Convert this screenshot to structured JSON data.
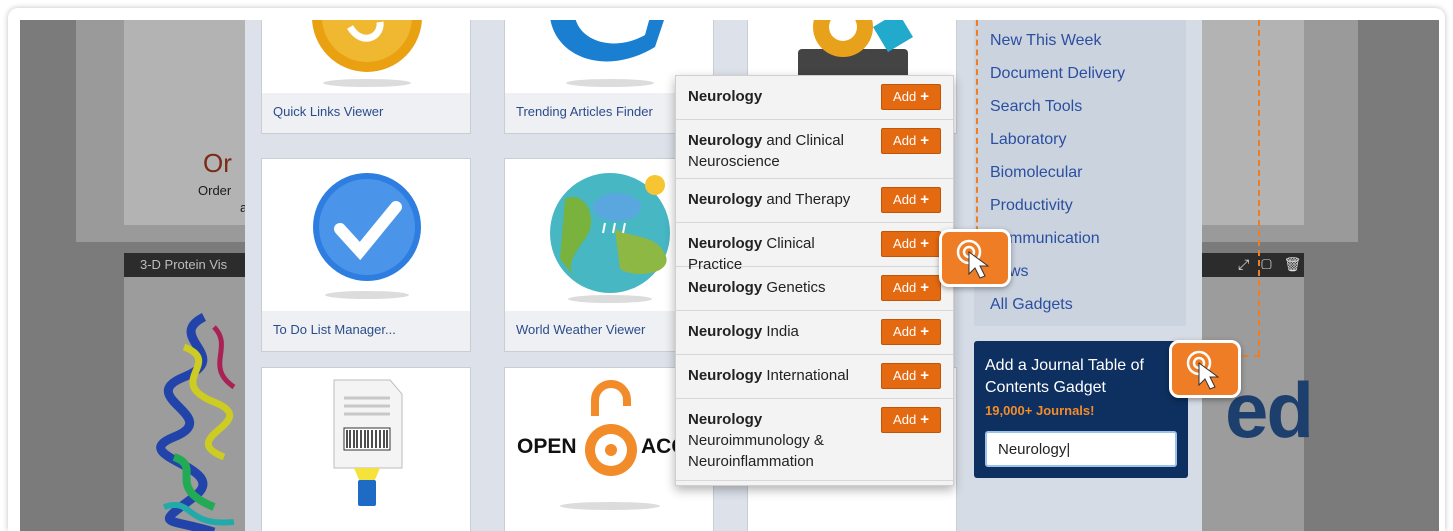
{
  "gallery": {
    "tiles": [
      {
        "caption": "Quick Links Viewer"
      },
      {
        "caption": "Trending Articles Finder"
      },
      {
        "caption": "To Do List Manager..."
      },
      {
        "caption": "World Weather Viewer"
      },
      {
        "caption": ""
      },
      {
        "caption": ""
      }
    ],
    "open_access_text": {
      "left": "OPEN",
      "right": "ACCE"
    }
  },
  "background": {
    "order_title": "Or",
    "order_text": "Order",
    "order_text2": "a",
    "panel_title": "3-D Protein Vis",
    "logo_fragment": "ed",
    "panel_tools": "⤢ ▢ 🗑"
  },
  "sidebar": {
    "categories": [
      "New This Week",
      "Document Delivery",
      "Search Tools",
      "Laboratory",
      "Biomolecular",
      "Productivity",
      "mmunication",
      "ws",
      "All Gadgets"
    ],
    "journal": {
      "title": "Add a Journal Table of Contents Gadget",
      "count": "19,000+ Journals!",
      "input_value": "Neurology|"
    }
  },
  "dropdown": {
    "add_label": "Add",
    "items": [
      {
        "bold": "Neurology",
        "rest": ""
      },
      {
        "bold": "Neurology",
        "rest": " and Clinical Neuroscience"
      },
      {
        "bold": "Neurology",
        "rest": " and Therapy"
      },
      {
        "bold": "Neurology",
        "rest": " Clinical Practice"
      },
      {
        "bold": "Neurology",
        "rest": " Genetics"
      },
      {
        "bold": "Neurology",
        "rest": " India"
      },
      {
        "bold": "Neurology",
        "rest": " International"
      },
      {
        "bold": "Neurology",
        "rest": " Neuroimmunology & Neuroinflammation"
      }
    ]
  },
  "colors": {
    "accent": "#e46a12",
    "brand": "#0e3060",
    "link": "#2b4fa0"
  }
}
